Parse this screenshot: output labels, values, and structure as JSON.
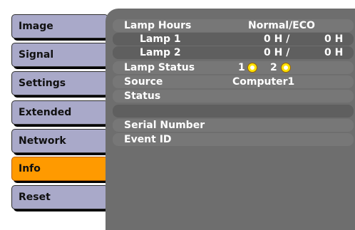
{
  "menu": {
    "items": [
      {
        "label": "Image"
      },
      {
        "label": "Signal"
      },
      {
        "label": "Settings"
      },
      {
        "label": "Extended"
      },
      {
        "label": "Network"
      },
      {
        "label": "Info",
        "active": true
      },
      {
        "label": "Reset"
      }
    ]
  },
  "info": {
    "lamp_hours_label": "Lamp Hours",
    "lamp_hours_mode": "Normal/ECO",
    "lamp1_label": "Lamp 1",
    "lamp1_normal": "0 H /",
    "lamp1_eco": "0 H",
    "lamp2_label": "Lamp 2",
    "lamp2_normal": "0 H /",
    "lamp2_eco": "0 H",
    "lamp_status_label": "Lamp Status",
    "lamp_status_1": "1",
    "lamp_status_2": "2",
    "source_label": "Source",
    "source_value": "Computer1",
    "status_label": "Status",
    "serial_label": "Serial Number",
    "event_label": "Event ID"
  },
  "colors": {
    "active_item": "#ff9a00",
    "menu_item": "#a9a9c9",
    "panel": "#6e6e6e",
    "lamp_indicator": "#ffe200"
  },
  "icons": [
    "lamp-indicator-icon"
  ]
}
